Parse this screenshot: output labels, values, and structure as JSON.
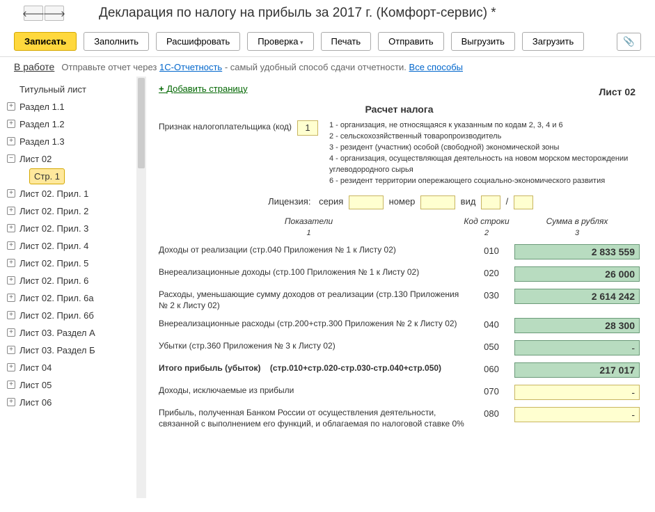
{
  "title": "Декларация по налогу на прибыль за 2017 г. (Комфорт-сервис) *",
  "toolbar": {
    "write": "Записать",
    "fill": "Заполнить",
    "decrypt": "Расшифровать",
    "check": "Проверка",
    "print": "Печать",
    "send": "Отправить",
    "export": "Выгрузить",
    "import": "Загрузить"
  },
  "status": {
    "inwork": "В работе",
    "text_before": "Отправьте отчет через ",
    "link1": "1С-Отчетность",
    "text_after": " - самый удобный способ сдачи отчетности. ",
    "link2": "Все способы"
  },
  "sidebar": {
    "items": [
      {
        "label": "Титульный лист",
        "icon": ""
      },
      {
        "label": "Раздел 1.1",
        "icon": "plus"
      },
      {
        "label": "Раздел 1.2",
        "icon": "plus"
      },
      {
        "label": "Раздел 1.3",
        "icon": "plus"
      },
      {
        "label": "Лист 02",
        "icon": "minus"
      },
      {
        "label": "Стр. 1",
        "icon": "",
        "child": true,
        "selected": true
      },
      {
        "label": "Лист 02. Прил. 1",
        "icon": "plus"
      },
      {
        "label": "Лист 02. Прил. 2",
        "icon": "plus"
      },
      {
        "label": "Лист 02. Прил. 3",
        "icon": "plus"
      },
      {
        "label": "Лист 02. Прил. 4",
        "icon": "plus"
      },
      {
        "label": "Лист 02. Прил. 5",
        "icon": "plus"
      },
      {
        "label": "Лист 02. Прил. 6",
        "icon": "plus"
      },
      {
        "label": "Лист 02. Прил. 6а",
        "icon": "plus"
      },
      {
        "label": "Лист 02. Прил. 6б",
        "icon": "plus"
      },
      {
        "label": "Лист 03. Раздел А",
        "icon": "plus"
      },
      {
        "label": "Лист 03. Раздел Б",
        "icon": "plus"
      },
      {
        "label": "Лист 04",
        "icon": "plus"
      },
      {
        "label": "Лист 05",
        "icon": "plus"
      },
      {
        "label": "Лист 06",
        "icon": "plus"
      }
    ]
  },
  "content": {
    "add_page": "Добавить страницу",
    "sheet": "Лист 02",
    "calc_title": "Расчет налога",
    "taxpayer_label": "Признак налогоплательщика (код)",
    "taxpayer_code": "1",
    "taxpayer_desc": "1 - организация, не относящаяся к указанным по кодам 2, 3, 4 и 6\n2 - сельскохозяйственный товаропроизводитель\n3 - резидент (участник) особой (свободной) экономической зоны\n4 - организация, осуществляющая деятельность на новом морском месторождении углеводородного сырья\n6 - резидент территории опережающего социально-экономического развития",
    "license": {
      "label": "Лицензия:",
      "series": "серия",
      "number": "номер",
      "type": "вид",
      "slash": "/"
    },
    "headers": {
      "h1": "Показатели",
      "h2": "Код строки",
      "h3": "Сумма в рублях",
      "n1": "1",
      "n2": "2",
      "n3": "3"
    },
    "rows": [
      {
        "label": "Доходы от реализации (стр.040 Приложения № 1 к Листу 02)",
        "code": "010",
        "value": "2 833 559",
        "style": "green"
      },
      {
        "label": "Внереализационные доходы (стр.100 Приложения № 1 к Листу 02)",
        "code": "020",
        "value": "26 000",
        "style": "green"
      },
      {
        "label": "Расходы, уменьшающие сумму доходов от реализации (стр.130 Приложения № 2 к Листу 02)",
        "code": "030",
        "value": "2 614 242",
        "style": "green"
      },
      {
        "label": "Внереализационные расходы (стр.200+стр.300 Приложения № 2 к Листу 02)",
        "code": "040",
        "value": "28 300",
        "style": "green"
      },
      {
        "label": "Убытки (стр.360 Приложения № 3 к Листу 02)",
        "code": "050",
        "value": "",
        "style": "green"
      },
      {
        "label": "Итого прибыль (убыток)",
        "extra": "(стр.010+стр.020-стр.030-стр.040+стр.050)",
        "code": "060",
        "value": "217 017",
        "style": "green",
        "bold": true
      },
      {
        "label": "Доходы, исключаемые из прибыли",
        "code": "070",
        "value": "",
        "style": "yellow"
      },
      {
        "label": "Прибыль, полученная Банком России от осуществления деятельности, связанной с выполнением его функций, и облагаемая по налоговой ставке 0%",
        "code": "080",
        "value": "",
        "style": "yellow"
      }
    ]
  }
}
